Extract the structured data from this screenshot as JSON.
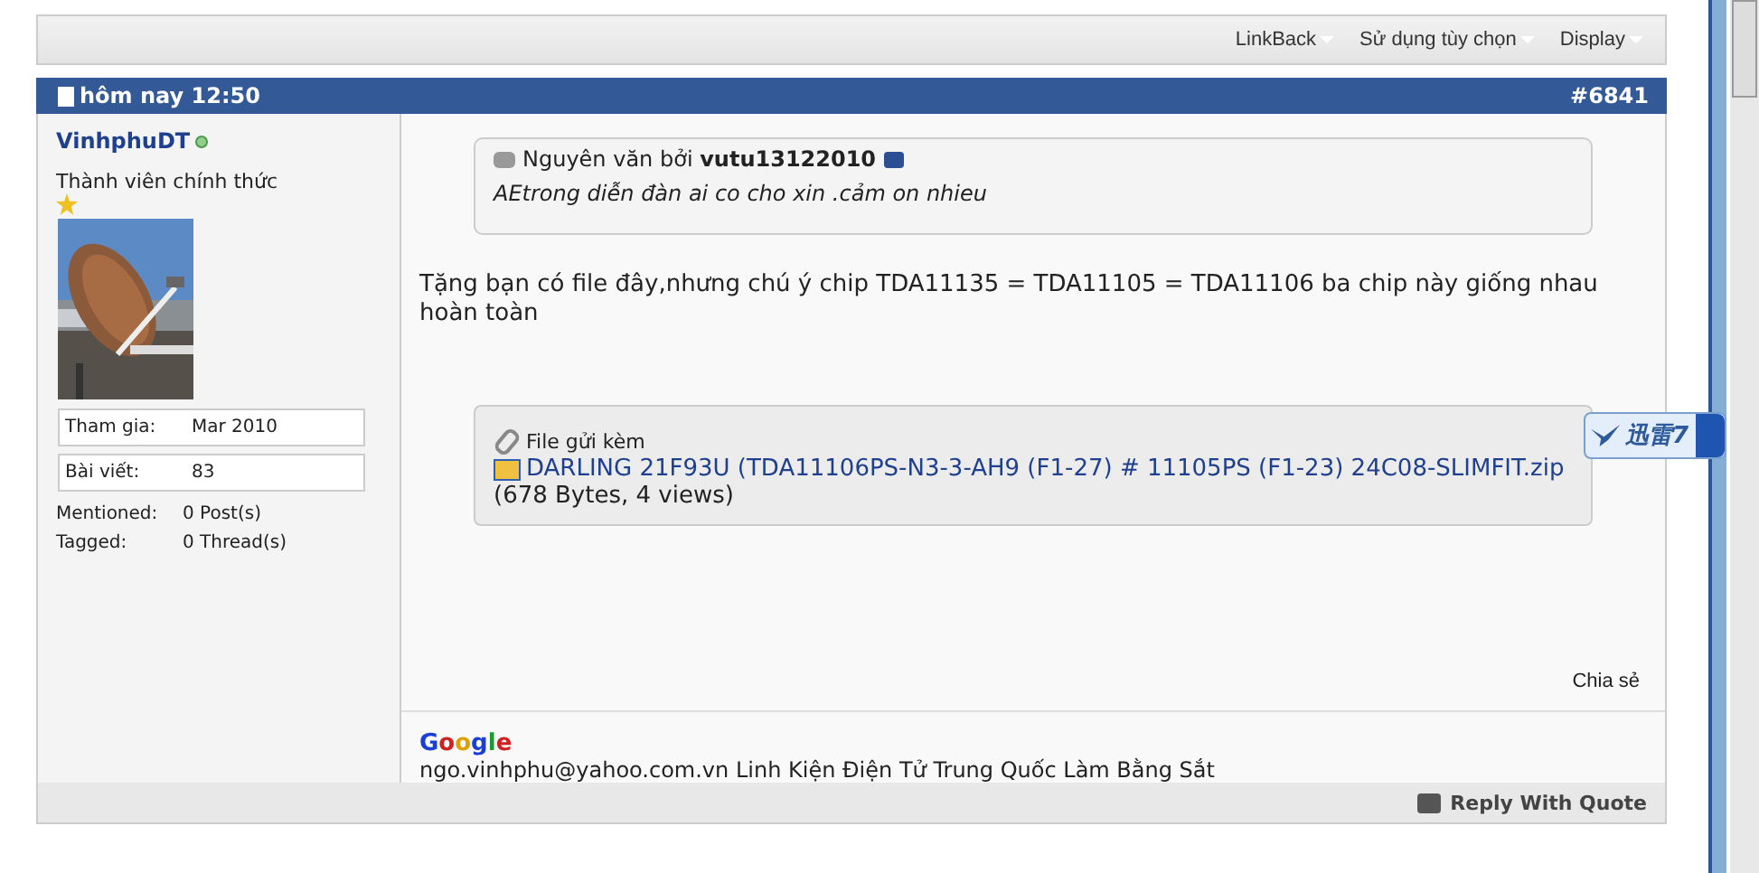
{
  "toolbar": {
    "menus": [
      "LinkBack",
      "Sử dụng tùy chọn",
      "Display"
    ]
  },
  "post_header": {
    "date": "hôm nay 12:50",
    "number": "#6841"
  },
  "author": {
    "name": "VinhphuDT",
    "online": true,
    "rank": "Thành viên chính thức",
    "stats": [
      {
        "label": "Tham gia:",
        "value": "Mar 2010",
        "boxed": true
      },
      {
        "label": "Bài viết:",
        "value": "83",
        "boxed": true
      },
      {
        "label": "Mentioned:",
        "value": "0 Post(s)",
        "boxed": false
      },
      {
        "label": "Tagged:",
        "value": "0 Thread(s)",
        "boxed": false
      }
    ]
  },
  "quote": {
    "prefix": "Nguyên văn bởi",
    "author": "vutu13122010",
    "text": "AEtrong diễn đàn ai co cho xin .cảm on nhieu"
  },
  "message": "Tặng bạn có file đây,nhưng chú ý chip TDA11135 = TDA11105 = TDA11106 ba chip này giống nhau hoàn toàn",
  "attachments": {
    "title": "File gửi kèm",
    "file": "DARLING 21F93U (TDA11106PS-N3-3-AH9 (F1-27) # 11105PS (F1-23) 24C08-SLIMFIT.zip",
    "info": "(678 Bytes, 4 views)"
  },
  "share": "Chia sẻ",
  "signature": {
    "logo": "Google",
    "text": "ngo.vinhphu@yahoo.com.vn Linh Kiện Điện Tử Trung Quốc Làm Bằng Sắt"
  },
  "reply_button": "Reply With Quote",
  "floating_badge": "迅雷7"
}
